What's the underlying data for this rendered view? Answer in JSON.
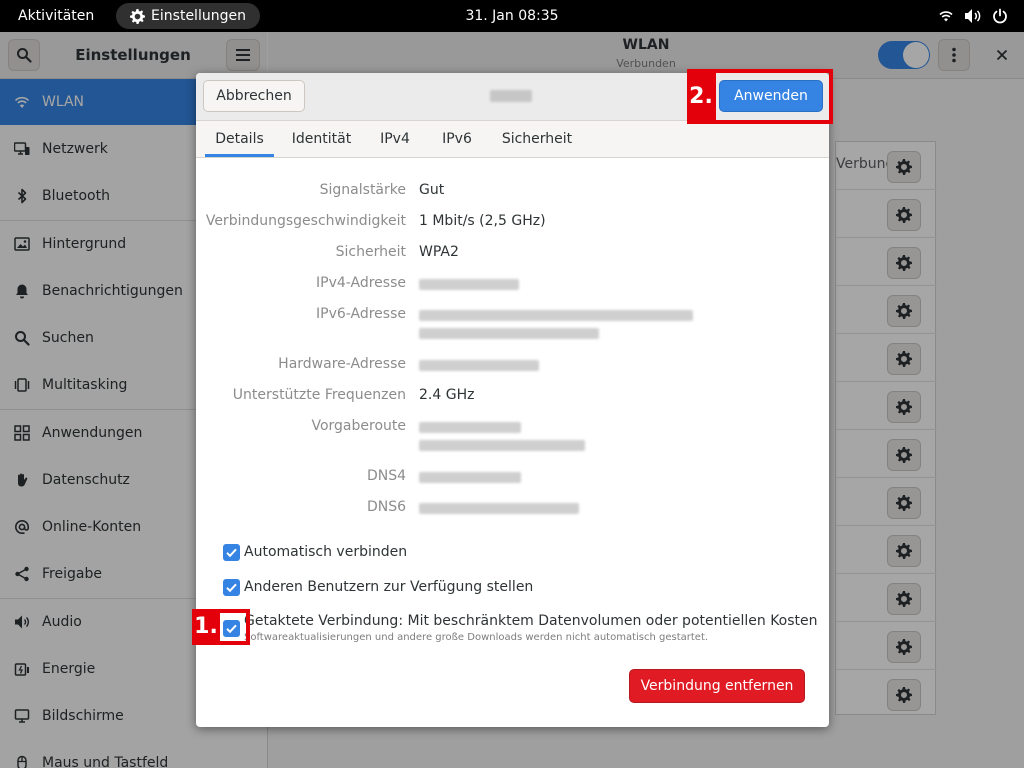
{
  "topbar": {
    "activities": "Aktivitäten",
    "app_name": "Einstellungen",
    "clock": "31. Jan  08:35"
  },
  "sidebar": {
    "title": "Einstellungen",
    "items": [
      {
        "label": "WLAN",
        "icon": "wifi-icon",
        "active": true
      },
      {
        "label": "Netzwerk",
        "icon": "network-icon"
      },
      {
        "label": "Bluetooth",
        "icon": "bluetooth-icon"
      },
      {
        "label": "Hintergrund",
        "icon": "background-icon"
      },
      {
        "label": "Benachrichtigungen",
        "icon": "bell-icon"
      },
      {
        "label": "Suchen",
        "icon": "search-icon"
      },
      {
        "label": "Multitasking",
        "icon": "multitasking-icon"
      },
      {
        "label": "Anwendungen",
        "icon": "apps-icon"
      },
      {
        "label": "Datenschutz",
        "icon": "hand-icon"
      },
      {
        "label": "Online-Konten",
        "icon": "at-icon"
      },
      {
        "label": "Freigabe",
        "icon": "share-icon"
      },
      {
        "label": "Audio",
        "icon": "speaker-icon"
      },
      {
        "label": "Energie",
        "icon": "power-icon"
      },
      {
        "label": "Bildschirme",
        "icon": "display-icon"
      },
      {
        "label": "Maus und Tastfeld",
        "icon": "mouse-icon"
      }
    ]
  },
  "header": {
    "title": "WLAN",
    "subtitle": "Verbunden",
    "switch_on": true
  },
  "network_list": {
    "connected_text": "Verbunden"
  },
  "dialog": {
    "cancel_label": "Abbrechen",
    "apply_label": "Anwenden",
    "tabs": [
      "Details",
      "Identität",
      "IPv4",
      "IPv6",
      "Sicherheit"
    ],
    "details": {
      "signal_label": "Signalstärke",
      "signal_value": "Gut",
      "speed_label": "Verbindungsgeschwindigkeit",
      "speed_value": "1 Mbit/s (2,5 GHz)",
      "security_label": "Sicherheit",
      "security_value": "WPA2",
      "ipv4_label": "IPv4-Adresse",
      "ipv6_label": "IPv6-Adresse",
      "hw_label": "Hardware-Adresse",
      "freq_label": "Unterstützte Frequenzen",
      "freq_value": "2.4 GHz",
      "route_label": "Vorgaberoute",
      "dns4_label": "DNS4",
      "dns6_label": "DNS6"
    },
    "checkboxes": {
      "auto_connect": "Automatisch verbinden",
      "available_all": "Anderen Benutzern zur Verfügung stellen",
      "metered": "Getaktete Verbindung: Mit beschränktem Datenvolumen oder potentiellen Kosten",
      "metered_desc": "Softwareaktualisierungen und andere große Downloads werden nicht automatisch gestartet."
    },
    "forget_label": "Verbindung entfernen"
  },
  "markers": {
    "one": "1.",
    "two": "2."
  },
  "colors": {
    "accent": "#3584e4",
    "destructive": "#e01b24",
    "marker": "#e4000a"
  }
}
